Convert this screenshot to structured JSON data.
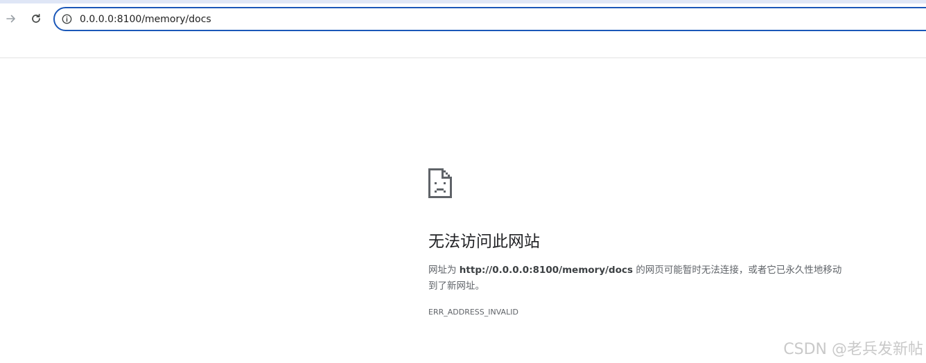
{
  "browser": {
    "address_bar": {
      "url": "0.0.0.0:8100/memory/docs"
    },
    "icons": {
      "forward": "arrow-right-icon",
      "reload": "reload-icon",
      "info": "info-icon"
    },
    "colors": {
      "omnibox_border": "#1a57b8",
      "top_strip": "#dfe6f6"
    }
  },
  "error_page": {
    "icon": "sad-page-icon",
    "title": "无法访问此网站",
    "description_prefix": "网址为 ",
    "description_url": "http://0.0.0.0:8100/memory/docs",
    "description_suffix": " 的网页可能暂时无法连接，或者它已永久性地移动到了新网址。",
    "error_code": "ERR_ADDRESS_INVALID"
  },
  "watermark": {
    "text": "CSDN @老兵发新帖"
  }
}
